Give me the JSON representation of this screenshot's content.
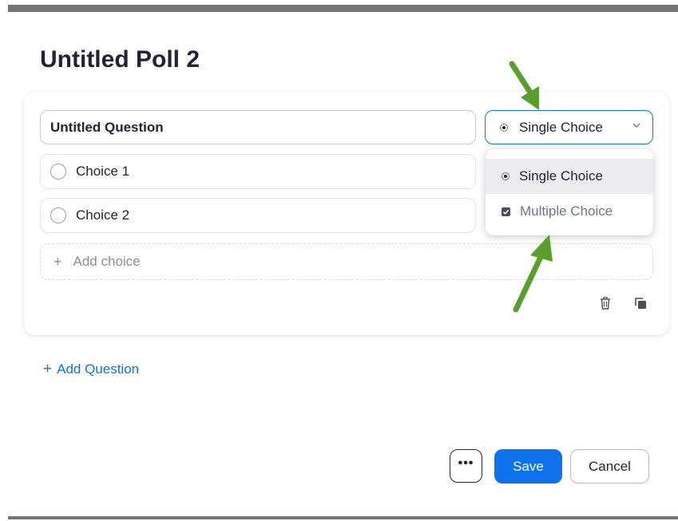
{
  "poll": {
    "title": "Untitled Poll 2"
  },
  "question": {
    "value": "Untitled Question",
    "type_label": "Single Choice",
    "choices": [
      {
        "label": "Choice 1"
      },
      {
        "label": "Choice 2"
      }
    ],
    "add_choice_label": "Add choice",
    "add_choice_plus": "+"
  },
  "type_dropdown": {
    "options": [
      {
        "label": "Single Choice",
        "selected": true
      },
      {
        "label": "Multiple Choice",
        "selected": false
      }
    ]
  },
  "add_question": {
    "plus": "+",
    "label": "Add Question"
  },
  "footer": {
    "more_label": "•••",
    "save_label": "Save",
    "cancel_label": "Cancel"
  },
  "colors": {
    "accent": "#0e72ed",
    "annotation_arrow": "#5a9e2e",
    "text": "#232333"
  },
  "icons": [
    "radio-selected-icon",
    "chevron-down-icon",
    "radio-empty-icon",
    "checkbox-icon",
    "trash-icon",
    "copy-icon",
    "plus-icon",
    "more-icon"
  ]
}
